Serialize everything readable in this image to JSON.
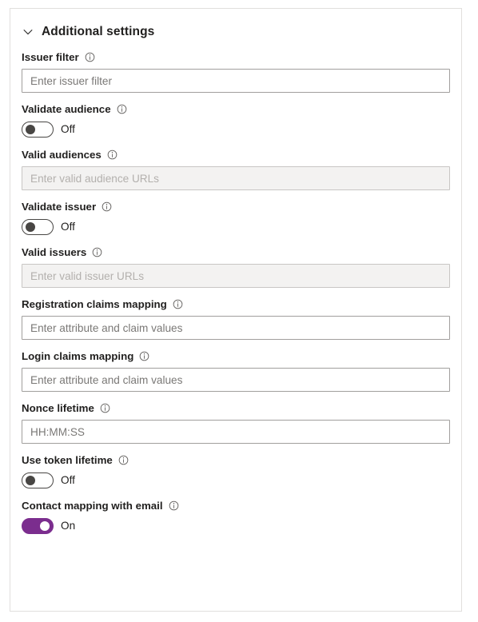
{
  "panel": {
    "header": {
      "title": "Additional settings",
      "chevron_icon": "chevron-down-icon",
      "expanded": true
    },
    "accent_color": "#7b2d8e",
    "border_color": "#e1dfdd",
    "disabled_field_bg": "#f3f2f1",
    "fields": [
      {
        "id": "issuer-filter",
        "label": "Issuer filter",
        "info_icon": "info-icon",
        "type": "text",
        "value": "",
        "placeholder": "Enter issuer filter",
        "disabled": false
      },
      {
        "id": "validate-audience",
        "label": "Validate audience",
        "info_icon": "info-icon",
        "type": "toggle",
        "state": "Off",
        "on": false
      },
      {
        "id": "valid-audiences",
        "label": "Valid audiences",
        "info_icon": "info-icon",
        "type": "text",
        "value": "",
        "placeholder": "Enter valid audience URLs",
        "disabled": true
      },
      {
        "id": "validate-issuer",
        "label": "Validate issuer",
        "info_icon": "info-icon",
        "type": "toggle",
        "state": "Off",
        "on": false
      },
      {
        "id": "valid-issuers",
        "label": "Valid issuers",
        "info_icon": "info-icon",
        "type": "text",
        "value": "",
        "placeholder": "Enter valid issuer URLs",
        "disabled": true
      },
      {
        "id": "registration-claims-mapping",
        "label": "Registration claims mapping",
        "info_icon": "info-icon",
        "type": "text",
        "value": "",
        "placeholder": "Enter attribute and claim values",
        "disabled": false
      },
      {
        "id": "login-claims-mapping",
        "label": "Login claims mapping",
        "info_icon": "info-icon",
        "type": "text",
        "value": "",
        "placeholder": "Enter attribute and claim values",
        "disabled": false
      },
      {
        "id": "nonce-lifetime",
        "label": "Nonce lifetime",
        "info_icon": "info-icon",
        "type": "text",
        "value": "",
        "placeholder": "HH:MM:SS",
        "disabled": false
      },
      {
        "id": "use-token-lifetime",
        "label": "Use token lifetime",
        "info_icon": "info-icon",
        "type": "toggle",
        "state": "Off",
        "on": false
      },
      {
        "id": "contact-mapping-with-email",
        "label": "Contact mapping with email",
        "info_icon": "info-icon",
        "type": "toggle",
        "state": "On",
        "on": true
      }
    ]
  }
}
